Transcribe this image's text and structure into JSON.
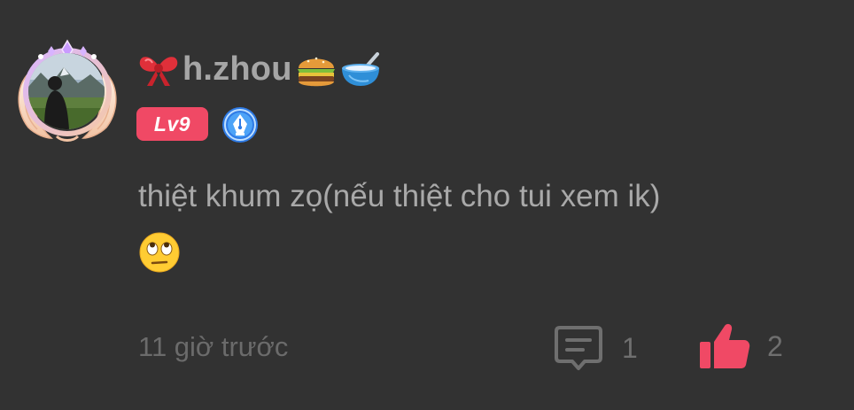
{
  "user": {
    "name": "h.zhou",
    "level": "Lv9"
  },
  "icons": {
    "avatar_frame": "angel-wing-frame-icon",
    "bow": "red-ribbon-bow-emoji",
    "burger": "hamburger-emoji",
    "bowl": "bowl-with-spoon-emoji",
    "level_badge": "level-badge",
    "pen": "fountain-pen-nib-badge-icon",
    "eye_roll": "face-with-rolling-eyes-emoji",
    "reply": "comment-bubble-icon",
    "like": "thumbs-up-icon"
  },
  "comment": {
    "text": "thiệt khum zọ(nếu thiệt cho tui xem ik)",
    "timestamp": "11 giờ trước"
  },
  "actions": {
    "reply_count": "1",
    "like_count": "2"
  },
  "colors": {
    "background": "#323232",
    "accent_pink": "#f04965",
    "text_primary": "#a9a9a9",
    "text_muted": "#6b6b6b",
    "pen_badge_blue": "#3f8ff5"
  }
}
